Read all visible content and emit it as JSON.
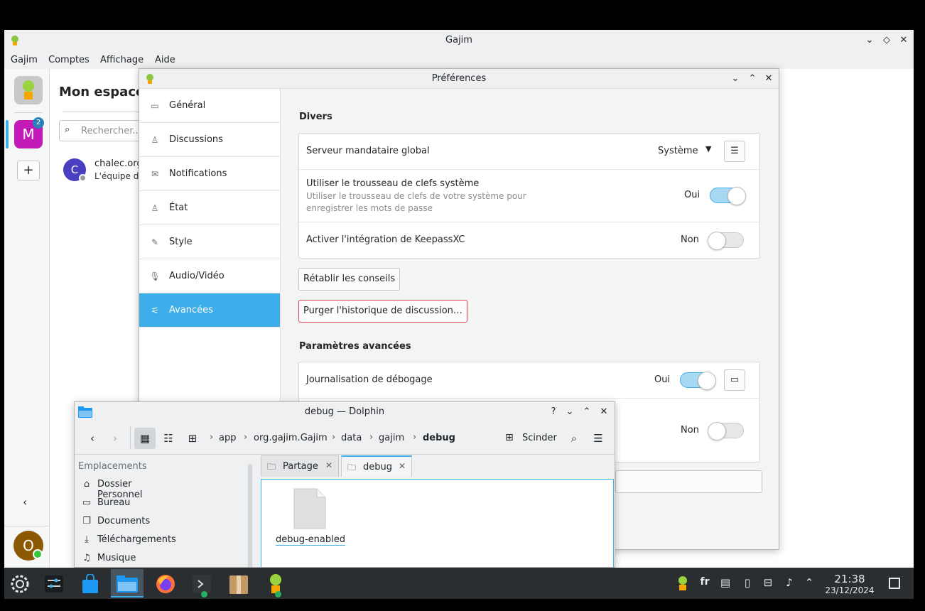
{
  "gajim": {
    "title": "Gajim",
    "menu": [
      "Gajim",
      "Comptes",
      "Affichage",
      "Aide"
    ],
    "account_letter": "M",
    "account_badge": "2",
    "add_label": "+",
    "panel_title": "Mon espace",
    "search_placeholder": "Rechercher...",
    "contact_initial": "C",
    "contact_name": "chalec.org",
    "contact_sub": "L'équipe du",
    "user_initial": "O"
  },
  "prefs": {
    "title": "Préférences",
    "sidebar": [
      {
        "label": "Général",
        "icon": "monitor-icon"
      },
      {
        "label": "Discussions",
        "icon": "person-icon"
      },
      {
        "label": "Notifications",
        "icon": "envelope-icon"
      },
      {
        "label": "État",
        "icon": "person-icon"
      },
      {
        "label": "Style",
        "icon": "brush-icon"
      },
      {
        "label": "Audio/Vidéo",
        "icon": "microphone-icon"
      },
      {
        "label": "Avancées",
        "icon": "sliders-icon"
      }
    ],
    "misc": {
      "title": "Divers",
      "proxy_label": "Serveur mandataire global",
      "proxy_value": "Système",
      "keyring_label": "Utiliser le trousseau de clefs système",
      "keyring_sub1": "Utiliser le trousseau de clefs de votre système pour",
      "keyring_sub2": "enregistrer les mots de passe",
      "keyring_state": "Oui",
      "keepass_label": "Activer l'intégration de KeepassXC",
      "keepass_state": "Non",
      "reset_hints": "Rétablir les conseils",
      "purge_history": "Purger l'historique de discussion…"
    },
    "advanced": {
      "title": "Paramètres avancées",
      "debug_label": "Journalisation de débogage",
      "debug_state": "Oui",
      "row2_state": "Non"
    }
  },
  "dolphin": {
    "title": "debug — Dolphin",
    "breadcrumb": [
      "app",
      "org.gajim.Gajim",
      "data",
      "gajim",
      "debug"
    ],
    "split_label": "Scinder",
    "places_header": "Emplacements",
    "places": [
      {
        "label": "Dossier Personnel",
        "icon": "home-icon"
      },
      {
        "label": "Bureau",
        "icon": "desktop-icon"
      },
      {
        "label": "Documents",
        "icon": "documents-icon"
      },
      {
        "label": "Téléchargements",
        "icon": "download-icon"
      },
      {
        "label": "Musique",
        "icon": "music-icon"
      }
    ],
    "tabs": [
      {
        "label": "Partage"
      },
      {
        "label": "debug"
      }
    ],
    "file_name": "debug-enabled"
  },
  "taskbar": {
    "lang": "fr",
    "time": "21:38",
    "date": "23/12/2024"
  },
  "colors": {
    "accent": "#3daee9",
    "account_tile": "#c21ab6",
    "contact_avatar": "#4a3fc1",
    "user_avatar": "#8b5a00",
    "online": "#35c83b"
  }
}
